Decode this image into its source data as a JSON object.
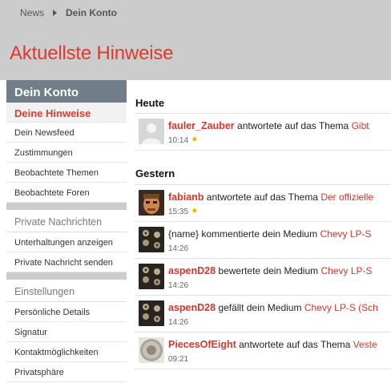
{
  "breadcrumb": {
    "items": [
      "News",
      "Dein Konto"
    ]
  },
  "page_title": "Aktuellste Hinweise",
  "sidebar": {
    "header": "Dein Konto",
    "account_items": [
      {
        "label": "Deine Hinweise",
        "active": true
      },
      {
        "label": "Dein Newsfeed"
      },
      {
        "label": "Zustimmungen"
      },
      {
        "label": "Beobachtete Themen"
      },
      {
        "label": "Beobachtete Foren"
      }
    ],
    "messages_title": "Private Nachrichten",
    "messages_items": [
      "Unterhaltungen anzeigen",
      "Private Nachricht senden"
    ],
    "settings_title": "Einstellungen",
    "settings_items": [
      "Persönliche Details",
      "Signatur",
      "Kontaktmöglichkeiten",
      "Privatsphäre"
    ]
  },
  "sections": [
    {
      "title": "Heute",
      "notifications": [
        {
          "user": "fauler_Zauber",
          "action": "antwortete auf das Thema",
          "link": "Gibt",
          "time": "10:14",
          "new": true,
          "avatar": "default-avatar-icon"
        }
      ]
    },
    {
      "title": "Gestern",
      "notifications": [
        {
          "user": "fabianb",
          "action": "antwortete auf das Thema",
          "link": "Der offizielle",
          "time": "15:35",
          "new": true,
          "avatar": "face-avatar"
        },
        {
          "user": "",
          "action": "{name} kommentierte dein Medium",
          "link": "Chevy LP-S",
          "time": "14:26",
          "new": false,
          "avatar": "knobs-avatar"
        },
        {
          "user": "aspenD28",
          "action": "bewertete dein Medium",
          "link": "Chevy LP-S",
          "time": "14:26",
          "new": false,
          "avatar": "knobs-avatar"
        },
        {
          "user": "aspenD28",
          "action": "gefällt dein Medium",
          "link": "Chevy LP-S (Sch",
          "time": "14:26",
          "new": false,
          "avatar": "knobs-avatar"
        },
        {
          "user": "PiecesOfEight",
          "action": "antwortete auf das Thema",
          "link": "Veste",
          "time": "09:21",
          "new": false,
          "avatar": "coin-avatar"
        }
      ]
    }
  ],
  "icons": {
    "new_marker": "star-icon"
  },
  "colors": {
    "accent": "#e03a2c",
    "sidebar_header": "#717d88",
    "topbar": "#cccccc",
    "star": "#e0c100"
  }
}
